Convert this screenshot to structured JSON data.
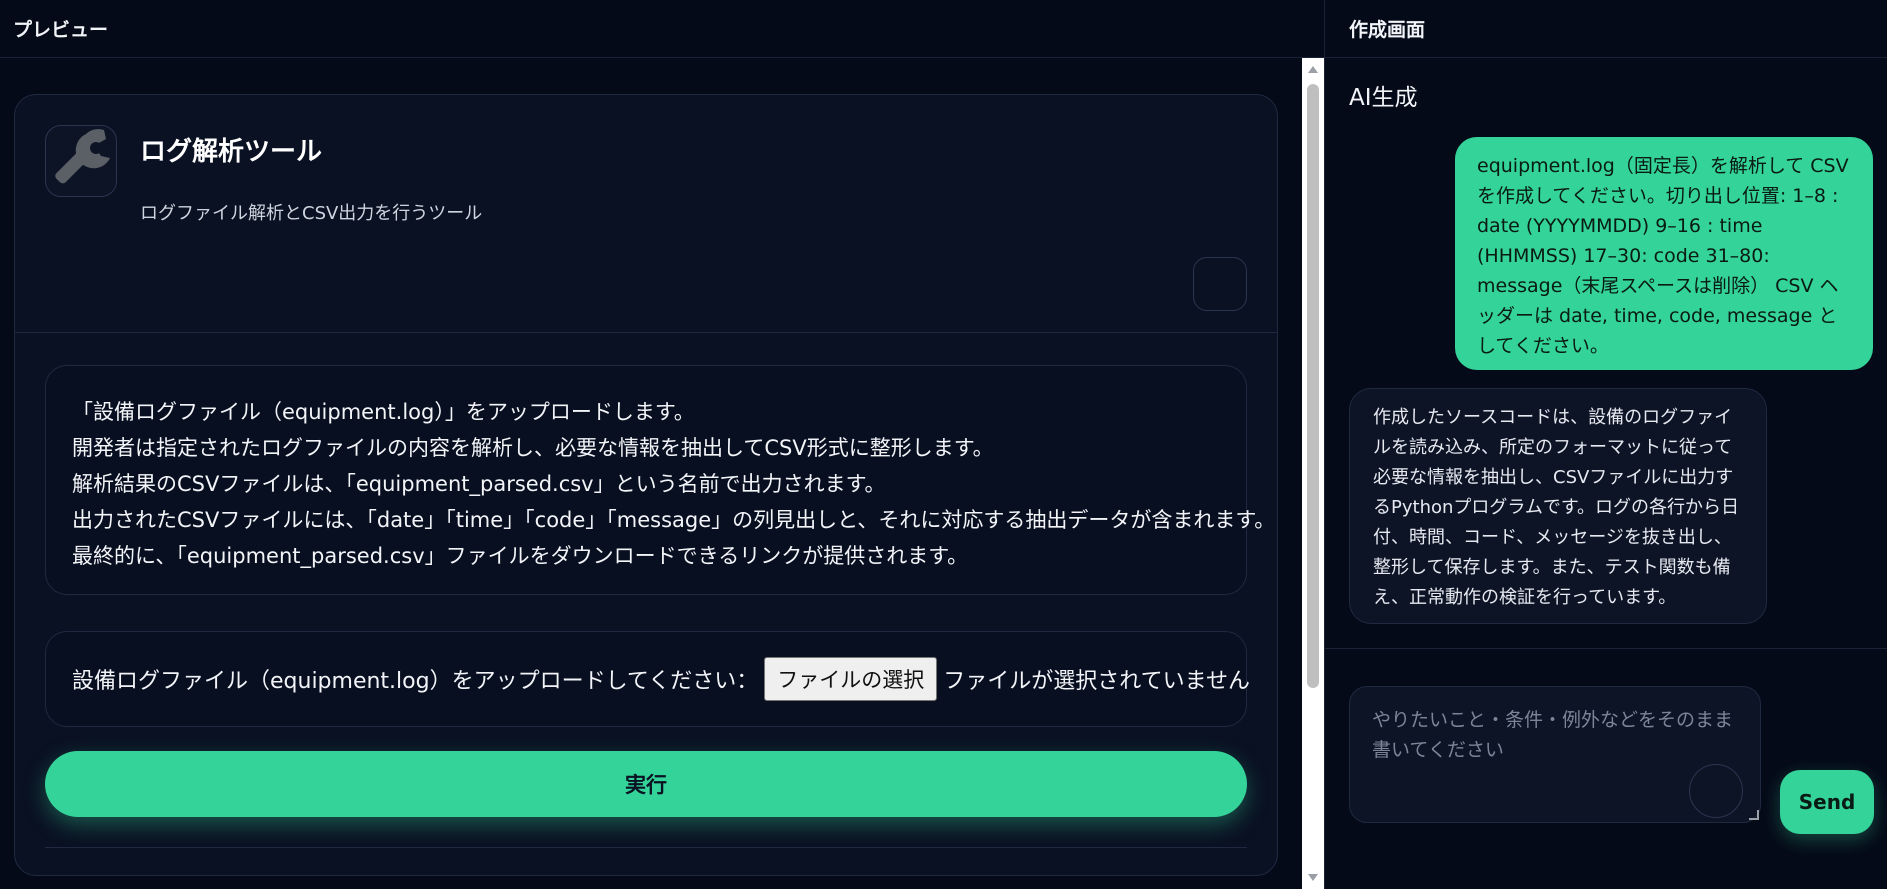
{
  "preview": {
    "header": "プレビュー",
    "tool": {
      "icon": "wrench-icon",
      "title": "ログ解析ツール",
      "description": "ログファイル解析とCSV出力を行うツール"
    },
    "instructions": [
      "「設備ログファイル（equipment.log）」をアップロードします。",
      "開発者は指定されたログファイルの内容を解析し、必要な情報を抽出してCSV形式に整形します。",
      "解析結果のCSVファイルは、「equipment_parsed.csv」という名前で出力されます。",
      "出力されたCSVファイルには、「date」「time」「code」「message」の列見出しと、それに対応する抽出データが含まれます。",
      "最終的に、「equipment_parsed.csv」ファイルをダウンロードできるリンクが提供されます。"
    ],
    "upload": {
      "label": "設備ログファイル（equipment.log）をアップロードしてください：",
      "button": "ファイルの選択",
      "status": "ファイルが選択されていません"
    },
    "run_button": "実行"
  },
  "create": {
    "header": "作成画面",
    "section_title": "AI生成",
    "messages": {
      "user": "equipment.log（固定長）を解析して CSV を作成してください。切り出し位置: 1–8 : date (YYYYMMDD) 9–16 : time (HHMMSS) 17–30: code 31–80: message（末尾スペースは削除） CSV ヘッダーは date, time, code, message としてください。",
      "ai": "作成したソースコードは、設備のログファイルを読み込み、所定のフォーマットに従って必要な情報を抽出し、CSVファイルに出力するPythonプログラムです。ログの各行から日付、時間、コード、メッセージを抜き出し、整形して保存します。また、テスト関数も備え、正常動作の検証を行っています。"
    },
    "input": {
      "placeholder": "やりたいこと・条件・例外などをそのまま書いてください",
      "value": ""
    },
    "send_button": "Send"
  },
  "colors": {
    "background": "#050a18",
    "card": "#0a1122",
    "accent": "#34d399",
    "border": "#1f2a40"
  }
}
